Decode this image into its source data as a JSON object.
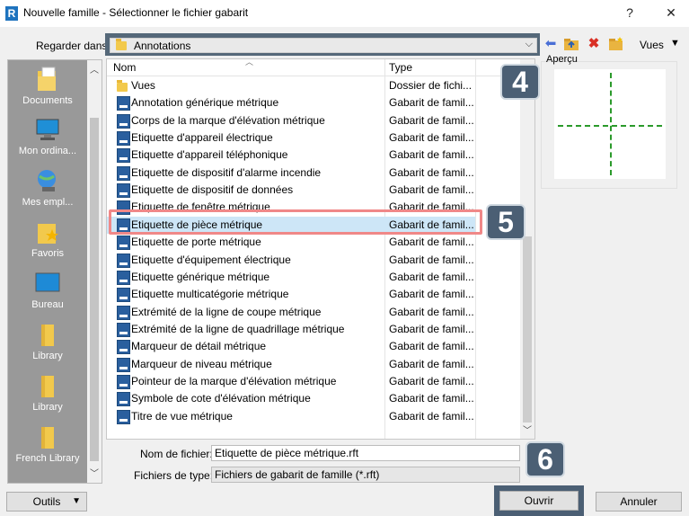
{
  "window": {
    "app_icon": "R",
    "title": "Nouvelle famille - Sélectionner le fichier gabarit",
    "help": "?",
    "close": "✕"
  },
  "lookin": {
    "label": "Regarder dans:",
    "value": "Annotations"
  },
  "toolbar": {
    "views_label": "Vues",
    "icons": [
      "back-arrow-icon",
      "up-folder-icon",
      "delete-icon",
      "new-folder-icon"
    ]
  },
  "places": [
    {
      "label": "Documents",
      "icon": "documents-icon"
    },
    {
      "label": "Mon ordina...",
      "icon": "computer-icon"
    },
    {
      "label": "Mes empl...",
      "icon": "network-icon"
    },
    {
      "label": "Favoris",
      "icon": "favorites-icon"
    },
    {
      "label": "Bureau",
      "icon": "desktop-icon"
    },
    {
      "label": "Library",
      "icon": "folder-icon"
    },
    {
      "label": "Library",
      "icon": "folder-icon"
    },
    {
      "label": "French Library",
      "icon": "folder-icon"
    }
  ],
  "list": {
    "headers": {
      "name": "Nom",
      "type": "Type"
    },
    "rows": [
      {
        "name": "Vues",
        "type": "Dossier de fichi...",
        "kind": "folder"
      },
      {
        "name": "Annotation générique métrique",
        "type": "Gabarit de famil...",
        "kind": "rft"
      },
      {
        "name": "Corps de la marque d'élévation métrique",
        "type": "Gabarit de famil...",
        "kind": "rft"
      },
      {
        "name": "Etiquette d'appareil électrique",
        "type": "Gabarit de famil...",
        "kind": "rft"
      },
      {
        "name": "Etiquette d'appareil téléphonique",
        "type": "Gabarit de famil...",
        "kind": "rft"
      },
      {
        "name": "Etiquette de dispositif d'alarme incendie",
        "type": "Gabarit de famil...",
        "kind": "rft"
      },
      {
        "name": "Etiquette de dispositif de données",
        "type": "Gabarit de famil...",
        "kind": "rft"
      },
      {
        "name": "Etiquette de fenêtre métrique",
        "type": "Gabarit de famil...",
        "kind": "rft"
      },
      {
        "name": "Etiquette de pièce métrique",
        "type": "Gabarit de famil...",
        "kind": "rft",
        "selected": true
      },
      {
        "name": "Etiquette de porte métrique",
        "type": "Gabarit de famil...",
        "kind": "rft"
      },
      {
        "name": "Etiquette d'équipement électrique",
        "type": "Gabarit de famil...",
        "kind": "rft"
      },
      {
        "name": "Etiquette générique métrique",
        "type": "Gabarit de famil...",
        "kind": "rft"
      },
      {
        "name": "Etiquette multicatégorie métrique",
        "type": "Gabarit de famil...",
        "kind": "rft"
      },
      {
        "name": "Extrémité de la ligne de coupe métrique",
        "type": "Gabarit de famil...",
        "kind": "rft"
      },
      {
        "name": "Extrémité de la ligne de quadrillage métrique",
        "type": "Gabarit de famil...",
        "kind": "rft"
      },
      {
        "name": "Marqueur de détail métrique",
        "type": "Gabarit de famil...",
        "kind": "rft"
      },
      {
        "name": "Marqueur de niveau métrique",
        "type": "Gabarit de famil...",
        "kind": "rft"
      },
      {
        "name": "Pointeur de la marque d'élévation métrique",
        "type": "Gabarit de famil...",
        "kind": "rft"
      },
      {
        "name": "Symbole de cote d'élévation métrique",
        "type": "Gabarit de famil...",
        "kind": "rft"
      },
      {
        "name": "Titre de vue métrique",
        "type": "Gabarit de famil...",
        "kind": "rft"
      }
    ]
  },
  "preview": {
    "label": "Aperçu"
  },
  "annotations": {
    "step4": "4",
    "step5": "5",
    "step6": "6"
  },
  "fields": {
    "filename_label": "Nom de fichier:",
    "filename_value": "Etiquette de pièce métrique.rft",
    "filetype_label": "Fichiers de type:",
    "filetype_value": "Fichiers de gabarit de famille  (*.rft)"
  },
  "buttons": {
    "tools": "Outils",
    "open": "Ouvrir",
    "cancel": "Annuler"
  },
  "colors": {
    "highlight_border": "#f08888",
    "badge_bg": "#4b5f74",
    "selection_bg": "#cde6f7"
  }
}
